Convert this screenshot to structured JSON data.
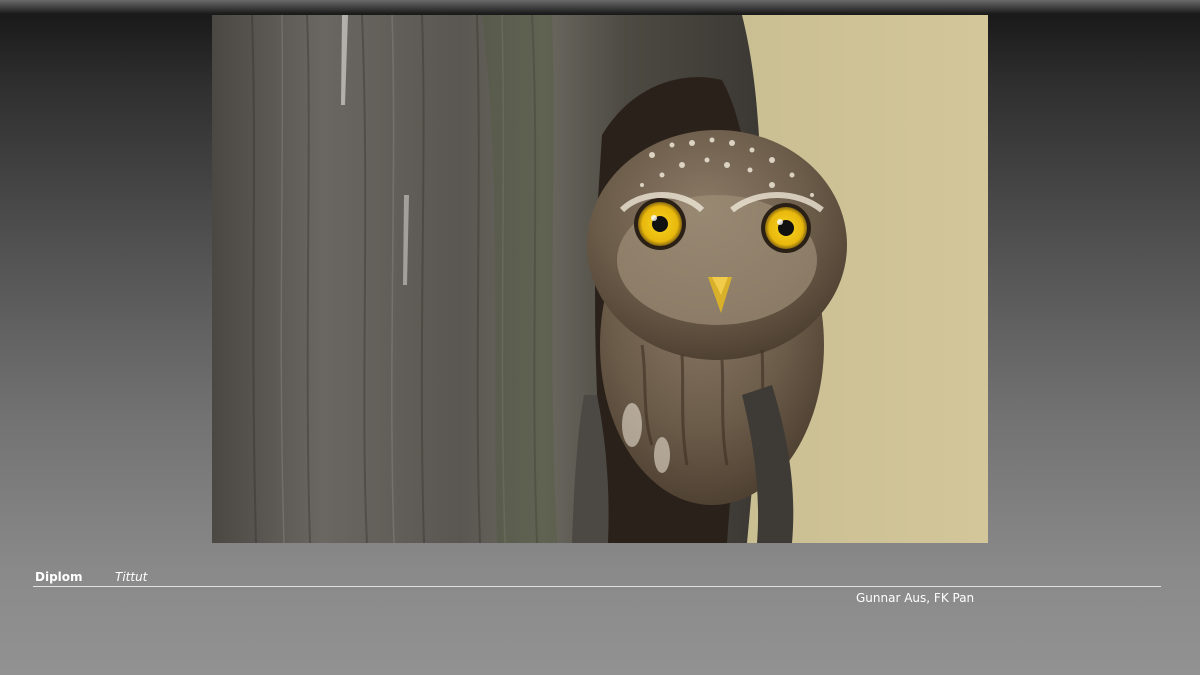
{
  "caption": {
    "award": "Diplom",
    "title": "Tittut",
    "author": "Gunnar Aus, FK Pan"
  },
  "photo": {
    "subject": "owl-peeking-from-tree-hole",
    "colors": {
      "background": "#c9bc8e",
      "bark": "#5e5a55",
      "eye": "#f2c414"
    }
  }
}
